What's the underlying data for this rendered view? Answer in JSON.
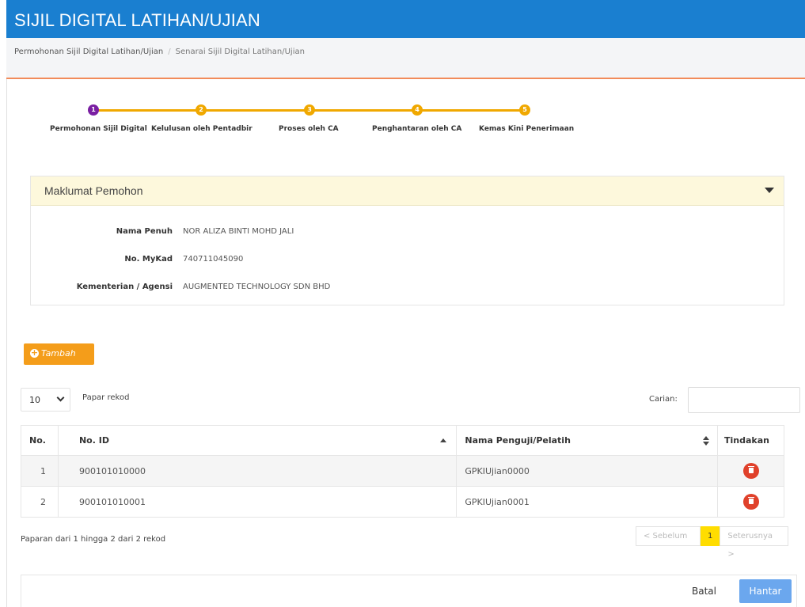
{
  "header": {
    "title": "SIJIL DIGITAL LATIHAN/UJIAN"
  },
  "breadcrumb": {
    "items": [
      "Permohonan Sijil Digital Latihan/Ujian",
      "Senarai Sijil Digital Latihan/Ujian"
    ],
    "separator": "/"
  },
  "stepper": {
    "steps": [
      {
        "number": "1",
        "label": "Permohonan Sijil Digital",
        "status": "done"
      },
      {
        "number": "2",
        "label": "Kelulusan oleh Pentadbir",
        "status": "pending"
      },
      {
        "number": "3",
        "label": "Proses oleh CA",
        "status": "pending"
      },
      {
        "number": "4",
        "label": "Penghantaran oleh CA",
        "status": "pending"
      },
      {
        "number": "5",
        "label": "Kemas Kini Penerimaan",
        "status": "pending"
      }
    ],
    "colors": {
      "done": "#7a1fa2",
      "pending": "#f0a800"
    }
  },
  "applicant": {
    "title": "Maklumat Pemohon",
    "fields": [
      {
        "label": "Nama Penuh",
        "value": "NOR ALIZA BINTI MOHD JALI"
      },
      {
        "label": "No. MyKad",
        "value": "740711045090"
      },
      {
        "label": "Kementerian / Agensi",
        "value": "AUGMENTED TECHNOLOGY SDN BHD"
      }
    ]
  },
  "toolbar": {
    "add_label": "Tambah",
    "page_length": "10",
    "page_length_label": "Papar rekod",
    "search_label": "Carian:",
    "search_value": ""
  },
  "table": {
    "headers": {
      "no": "No.",
      "id": "No. ID",
      "name": "Nama Penguji/Pelatih",
      "action": "Tindakan"
    },
    "rows": [
      {
        "no": "1",
        "id": "900101010000",
        "name": "GPKIUjian0000"
      },
      {
        "no": "2",
        "id": "900101010001",
        "name": "GPKIUjian0001"
      }
    ]
  },
  "footer": {
    "summary": "Paparan dari 1 hingga 2 dari 2 rekod",
    "prev_label": "< Sebelum",
    "current_page": "1",
    "next_label": "Seterusnya >"
  },
  "actions": {
    "cancel_label": "Batal",
    "submit_label": "Hantar"
  },
  "colors": {
    "header_bg": "#1a7fd0",
    "accent_orange": "#f49d1a",
    "delete_red": "#e0412b",
    "submit_blue": "#6ba7ee",
    "active_page": "#ffdd00"
  }
}
